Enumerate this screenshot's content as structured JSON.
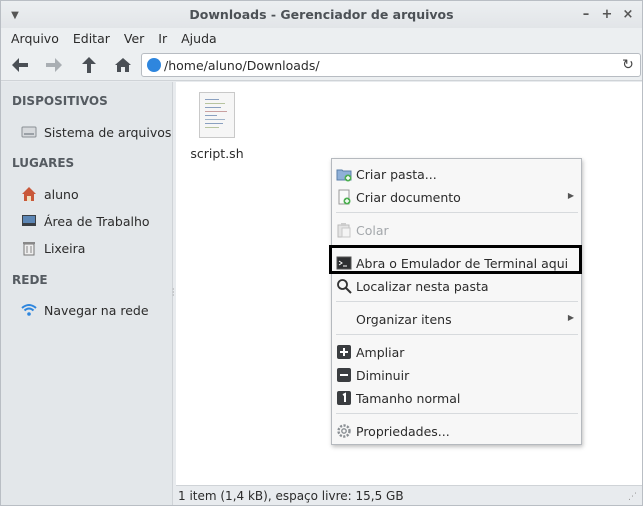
{
  "window": {
    "title": "Downloads - Gerenciador de arquivos"
  },
  "menubar": {
    "items": [
      "Arquivo",
      "Editar",
      "Ver",
      "Ir",
      "Ajuda"
    ]
  },
  "toolbar": {
    "address": "/home/aluno/Downloads/"
  },
  "sidebar": {
    "sections": [
      {
        "heading": "DISPOSITIVOS",
        "items": [
          {
            "label": "Sistema de arquivos",
            "icon": "drive-icon"
          }
        ]
      },
      {
        "heading": "LUGARES",
        "items": [
          {
            "label": "aluno",
            "icon": "home-icon"
          },
          {
            "label": "Área de Trabalho",
            "icon": "desktop-icon"
          },
          {
            "label": "Lixeira",
            "icon": "trash-icon"
          }
        ]
      },
      {
        "heading": "REDE",
        "items": [
          {
            "label": "Navegar na rede",
            "icon": "wifi-icon"
          }
        ]
      }
    ]
  },
  "files": [
    {
      "name": "script.sh",
      "icon": "shell-script-icon"
    }
  ],
  "status": {
    "text": "1 item (1,4 kB), espaço livre: 15,5 GB"
  },
  "context_menu": {
    "items": [
      {
        "label": "Criar pasta...",
        "icon": "new-folder-icon",
        "enabled": true
      },
      {
        "label": "Criar documento",
        "icon": "new-document-icon",
        "enabled": true,
        "submenu": true
      },
      {
        "label": "Colar",
        "icon": "paste-icon",
        "enabled": false
      },
      {
        "label": "Abra o Emulador de Terminal aqui",
        "icon": "terminal-icon",
        "enabled": true,
        "highlighted": true
      },
      {
        "label": "Localizar nesta pasta",
        "icon": "search-icon",
        "enabled": true
      },
      {
        "label": "Organizar itens",
        "enabled": true,
        "submenu": true
      },
      {
        "label": "Ampliar",
        "icon": "zoom-in-icon",
        "enabled": true
      },
      {
        "label": "Diminuir",
        "icon": "zoom-out-icon",
        "enabled": true
      },
      {
        "label": "Tamanho normal",
        "icon": "zoom-reset-icon",
        "enabled": true
      },
      {
        "label": "Propriedades...",
        "icon": "properties-icon",
        "enabled": true
      }
    ]
  },
  "colors": {
    "highlight_border": "#000000",
    "accent": "#2e86de",
    "disabled_text": "#a3a7ab"
  }
}
